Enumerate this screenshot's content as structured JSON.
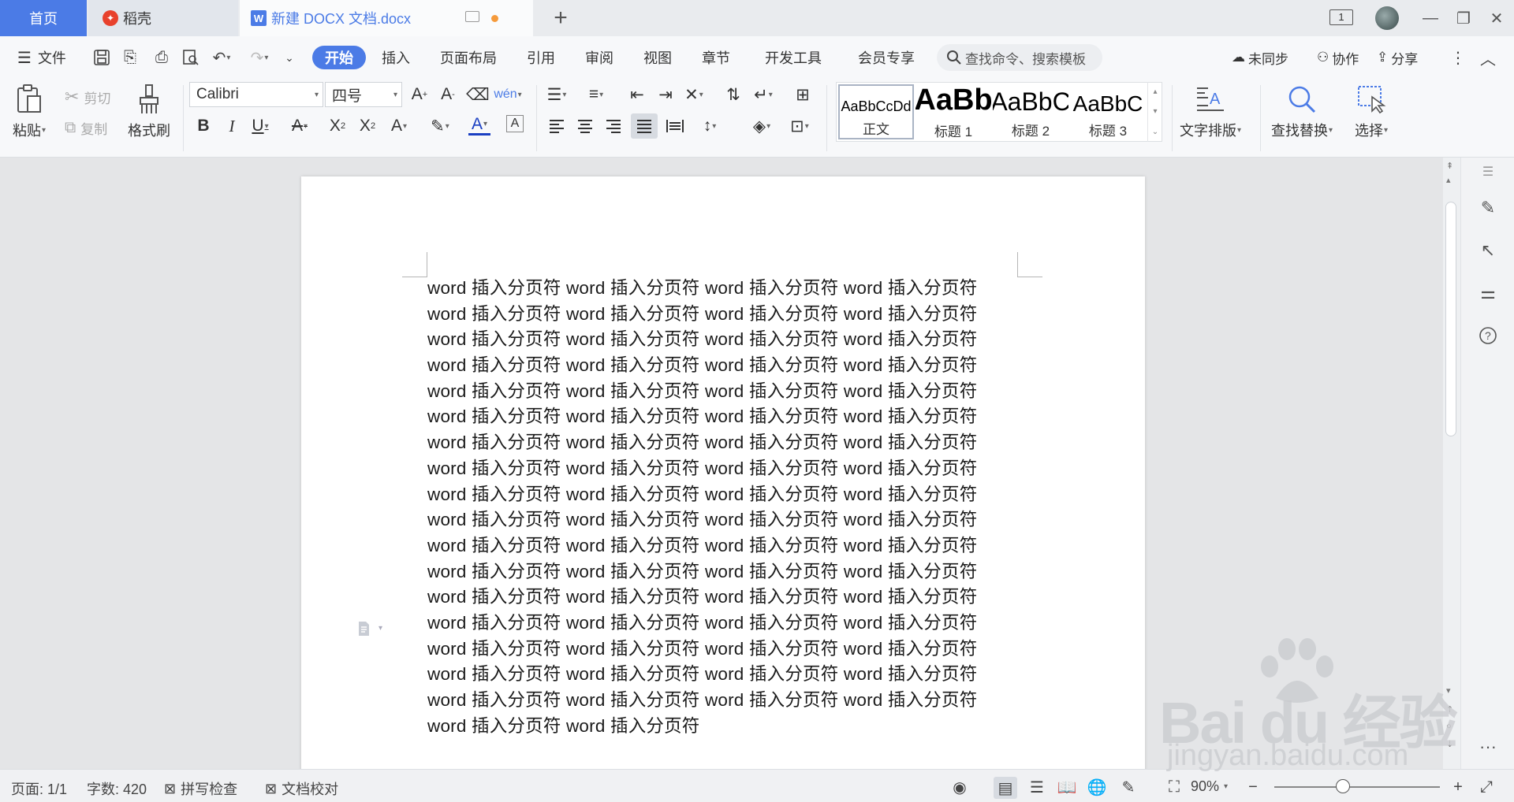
{
  "titlebar": {
    "tab_home": "首页",
    "tab_daoke": "稻壳",
    "tab_doc": "新建 DOCX 文档.docx",
    "page_count": "1"
  },
  "menubar": {
    "file": "文件",
    "tabs": [
      "开始",
      "插入",
      "页面布局",
      "引用",
      "审阅",
      "视图",
      "章节",
      "开发工具",
      "会员专享"
    ],
    "active_tab": "开始",
    "search_placeholder": "查找命令、搜索模板",
    "sync": "未同步",
    "collab": "协作",
    "share": "分享"
  },
  "ribbon": {
    "paste": "粘贴",
    "cut": "剪切",
    "copy": "复制",
    "format_painter": "格式刷",
    "font_name": "Calibri",
    "font_size": "四号",
    "styles": [
      {
        "preview": "AaBbCcDd",
        "label": "正文"
      },
      {
        "preview": "AaBb",
        "label": "标题 1"
      },
      {
        "preview": "AaBbC",
        "label": "标题 2"
      },
      {
        "preview": "AaBbC",
        "label": "标题 3"
      }
    ],
    "text_layout": "文字排版",
    "find_replace": "查找替换",
    "select": "选择"
  },
  "document": {
    "lines": [
      "word 插入分页符 word 插入分页符 word 插入分页符 word 插入分页符",
      "word 插入分页符 word 插入分页符 word 插入分页符 word 插入分页符",
      "word 插入分页符 word 插入分页符 word 插入分页符 word 插入分页符",
      "word 插入分页符 word 插入分页符 word 插入分页符 word 插入分页符",
      "word 插入分页符 word 插入分页符 word 插入分页符 word 插入分页符",
      "word 插入分页符 word 插入分页符 word 插入分页符 word 插入分页符",
      "word 插入分页符 word 插入分页符 word 插入分页符 word 插入分页符",
      "word 插入分页符 word 插入分页符 word 插入分页符 word 插入分页符",
      "word 插入分页符 word 插入分页符 word 插入分页符 word 插入分页符",
      "word 插入分页符 word 插入分页符 word 插入分页符 word 插入分页符",
      "word 插入分页符 word 插入分页符 word 插入分页符 word 插入分页符",
      "word 插入分页符 word 插入分页符 word 插入分页符 word 插入分页符",
      "word 插入分页符 word 插入分页符 word 插入分页符 word 插入分页符",
      "word 插入分页符 word 插入分页符 word 插入分页符 word 插入分页符",
      "word 插入分页符 word 插入分页符 word 插入分页符 word 插入分页符",
      "word 插入分页符 word 插入分页符 word 插入分页符 word 插入分页符",
      "word 插入分页符 word 插入分页符 word 插入分页符 word 插入分页符",
      "word 插入分页符 word 插入分页符"
    ]
  },
  "statusbar": {
    "page": "页面: 1/1",
    "words": "字数: 420",
    "spell": "拼写检查",
    "proof": "文档校对",
    "zoom": "90%"
  },
  "watermark": {
    "main": "Bai du 经验",
    "sub": "jingyan.baidu.com"
  },
  "colors": {
    "accent": "#4b7be6",
    "tab_dot": "#f59a3b",
    "daoke_logo": "#e8412c"
  }
}
